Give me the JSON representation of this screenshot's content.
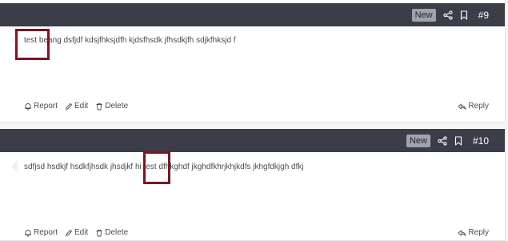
{
  "posts": [
    {
      "badge": "New",
      "number": "#9",
      "body": "test beang dsfjdf kdsjfhksjdfh kjdsfhsdk jfhsdkjfh sdjkfhksjd f",
      "actions": {
        "report": "Report",
        "edit": "Edit",
        "delete": "Delete",
        "reply": "Reply"
      }
    },
    {
      "badge": "New",
      "number": "#10",
      "body": "sdfjsd hsdkjf hsdkfjhsdk jhsdjkf hi test dfhkghdf jkghdfkhrjkhjkdfs jkhgfdkjgh dfkj",
      "actions": {
        "report": "Report",
        "edit": "Edit",
        "delete": "Delete",
        "reply": "Reply"
      }
    }
  ],
  "colors": {
    "header": "#3b3e49",
    "highlight": "#7a1622",
    "badge": "#9fa3ac"
  },
  "icons": [
    "share-icon",
    "bookmark-icon",
    "report-icon",
    "edit-icon",
    "delete-icon",
    "reply-icon"
  ]
}
